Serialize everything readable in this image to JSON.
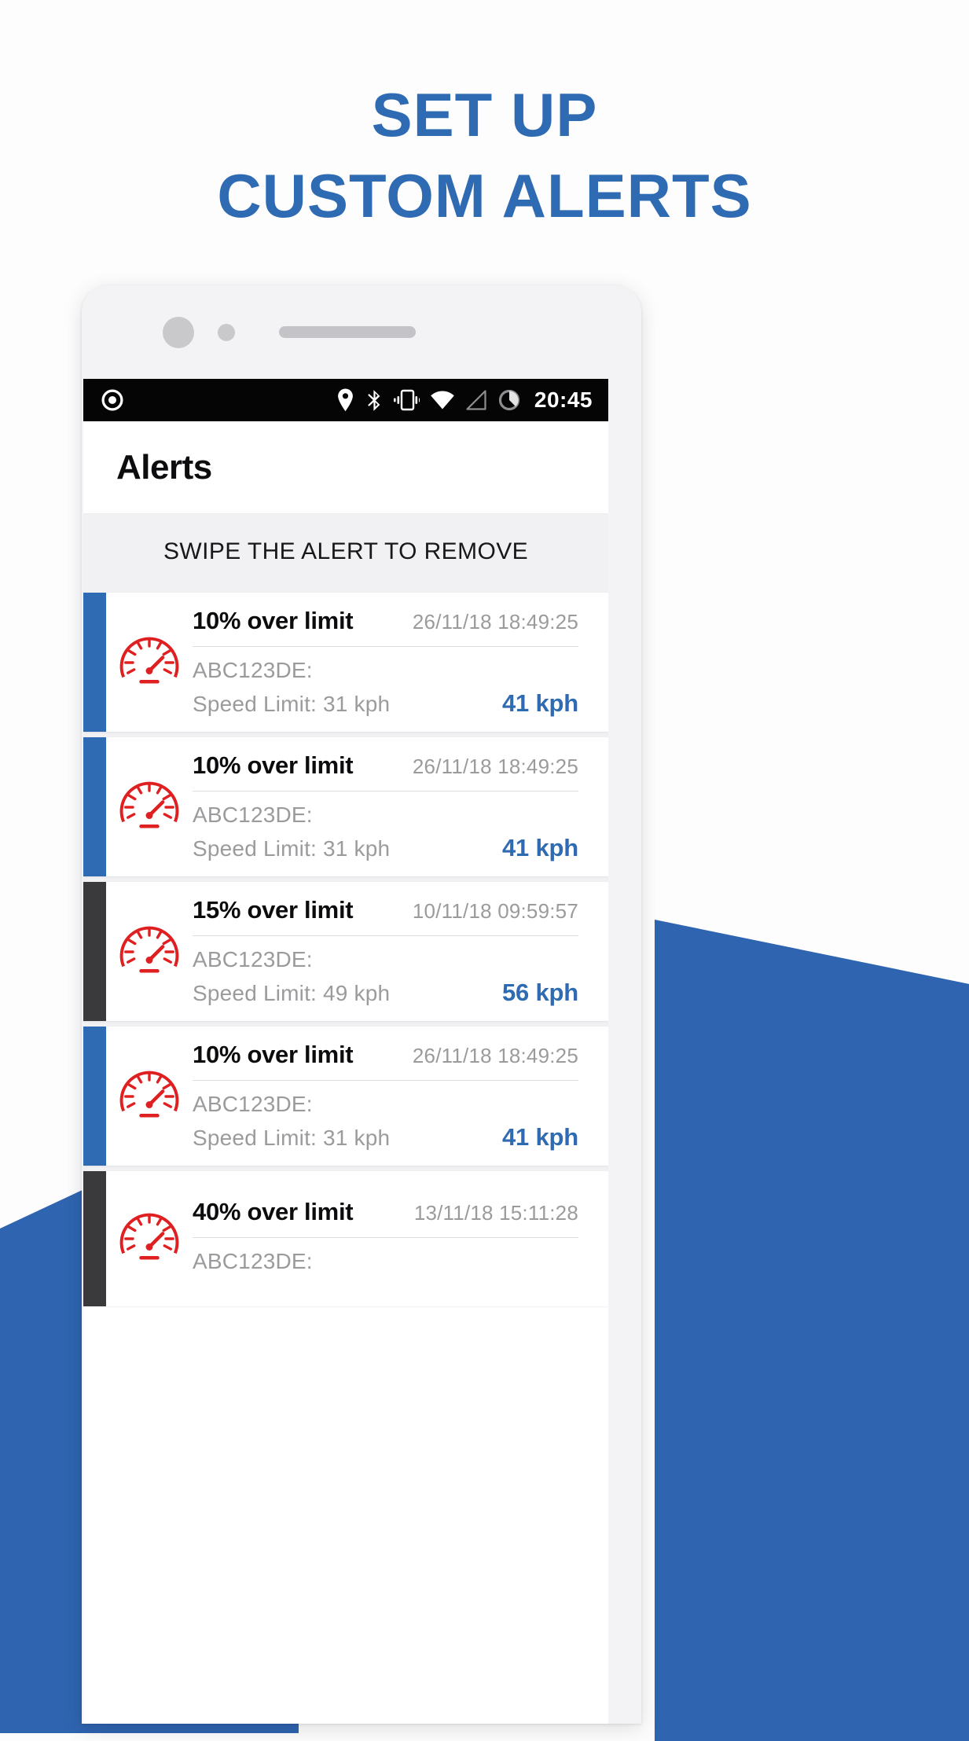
{
  "marketing": {
    "headline_lines": [
      "SET UP",
      "CUSTOM ALERTS"
    ],
    "headline_color": "#2f6bb3",
    "background_shape_color": "#2f64b0"
  },
  "phone": {
    "status_bar": {
      "left_icons": [
        "record-circle-icon"
      ],
      "right_icons": [
        "location-pin-icon",
        "bluetooth-icon",
        "vibrate-icon",
        "wifi-icon",
        "cell-signal-icon",
        "battery-circle-icon"
      ],
      "clock": "20:45"
    },
    "app_bar": {
      "title": "Alerts"
    },
    "banner": {
      "text": "SWIPE THE ALERT TO REMOVE"
    },
    "list": {
      "icon_name": "speedometer-icon",
      "icon_color": "#e02020",
      "accent_blue": "#2f6bb3",
      "accent_dark": "#3a3a3c",
      "speed_color": "#2f6bb3",
      "alerts": [
        {
          "title": "10% over limit",
          "time": "26/11/18 18:49:25",
          "plate": "ABC123DE:",
          "limit": "Speed Limit: 31 kph",
          "speed": "41 kph",
          "accent": "blue"
        },
        {
          "title": "10% over limit",
          "time": "26/11/18 18:49:25",
          "plate": "ABC123DE:",
          "limit": "Speed Limit: 31 kph",
          "speed": "41 kph",
          "accent": "blue"
        },
        {
          "title": "15% over limit",
          "time": "10/11/18 09:59:57",
          "plate": "ABC123DE:",
          "limit": "Speed Limit: 49 kph",
          "speed": "56 kph",
          "accent": "dark"
        },
        {
          "title": "10% over limit",
          "time": "26/11/18 18:49:25",
          "plate": "ABC123DE:",
          "limit": "Speed Limit: 31 kph",
          "speed": "41 kph",
          "accent": "blue"
        },
        {
          "title": "40% over limit",
          "time": "13/11/18 15:11:28",
          "plate": "ABC123DE:",
          "limit": "",
          "speed": "",
          "accent": "dark"
        }
      ]
    }
  }
}
